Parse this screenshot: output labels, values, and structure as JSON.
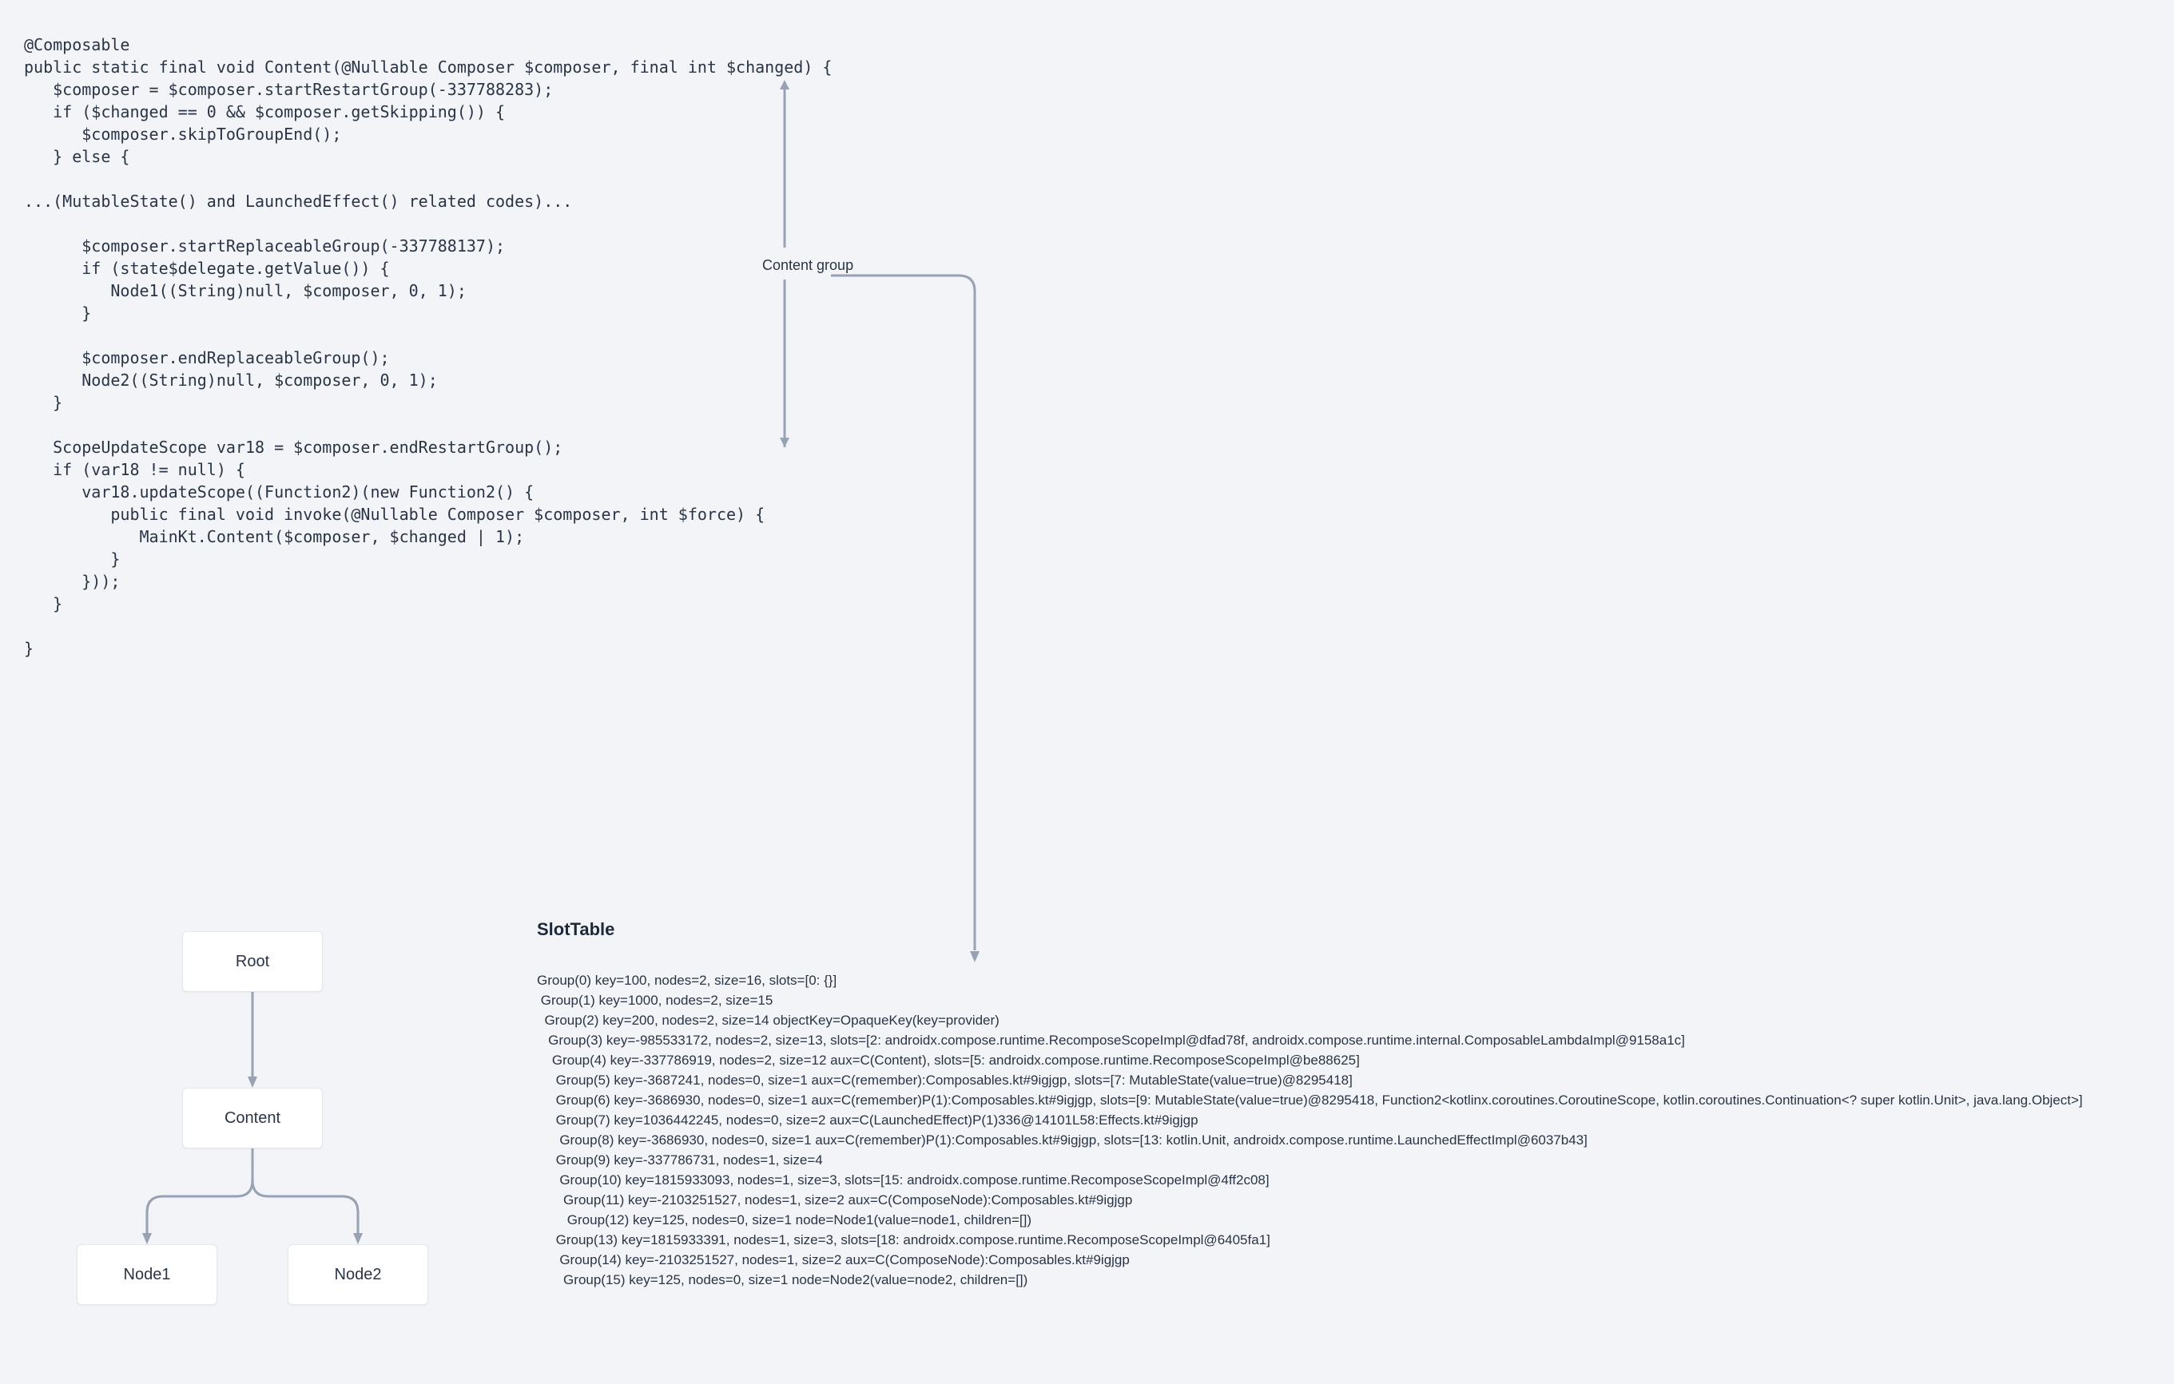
{
  "code": "@Composable\npublic static final void Content(@Nullable Composer $composer, final int $changed) {\n   $composer = $composer.startRestartGroup(-337788283);\n   if ($changed == 0 && $composer.getSkipping()) {\n      $composer.skipToGroupEnd();\n   } else {\n\n...(MutableState() and LaunchedEffect() related codes)...\n\n      $composer.startReplaceableGroup(-337788137);\n      if (state$delegate.getValue()) {\n         Node1((String)null, $composer, 0, 1);\n      }\n\n      $composer.endReplaceableGroup();\n      Node2((String)null, $composer, 0, 1);\n   }\n\n   ScopeUpdateScope var18 = $composer.endRestartGroup();\n   if (var18 != null) {\n      var18.updateScope((Function2)(new Function2() {\n         public final void invoke(@Nullable Composer $composer, int $force) {\n            MainKt.Content($composer, $changed | 1);\n         }\n      }));\n   }\n\n}",
  "contentGroupLabel": "Content group",
  "tree": {
    "root": "Root",
    "content": "Content",
    "node1": "Node1",
    "node2": "Node2"
  },
  "slotTable": {
    "title": "SlotTable",
    "text": "Group(0) key=100, nodes=2, size=16, slots=[0: {}]\n Group(1) key=1000, nodes=2, size=15\n  Group(2) key=200, nodes=2, size=14 objectKey=OpaqueKey(key=provider)\n   Group(3) key=-985533172, nodes=2, size=13, slots=[2: androidx.compose.runtime.RecomposeScopeImpl@dfad78f, androidx.compose.runtime.internal.ComposableLambdaImpl@9158a1c]\n    Group(4) key=-337786919, nodes=2, size=12 aux=C(Content), slots=[5: androidx.compose.runtime.RecomposeScopeImpl@be88625]\n     Group(5) key=-3687241, nodes=0, size=1 aux=C(remember):Composables.kt#9igjgp, slots=[7: MutableState(value=true)@8295418]\n     Group(6) key=-3686930, nodes=0, size=1 aux=C(remember)P(1):Composables.kt#9igjgp, slots=[9: MutableState(value=true)@8295418, Function2<kotlinx.coroutines.CoroutineScope, kotlin.coroutines.Continuation<? super kotlin.Unit>, java.lang.Object>]\n     Group(7) key=1036442245, nodes=0, size=2 aux=C(LaunchedEffect)P(1)336@14101L58:Effects.kt#9igjgp\n      Group(8) key=-3686930, nodes=0, size=1 aux=C(remember)P(1):Composables.kt#9igjgp, slots=[13: kotlin.Unit, androidx.compose.runtime.LaunchedEffectImpl@6037b43]\n     Group(9) key=-337786731, nodes=1, size=4\n      Group(10) key=1815933093, nodes=1, size=3, slots=[15: androidx.compose.runtime.RecomposeScopeImpl@4ff2c08]\n       Group(11) key=-2103251527, nodes=1, size=2 aux=C(ComposeNode):Composables.kt#9igjgp\n        Group(12) key=125, nodes=0, size=1 node=Node1(value=node1, children=[])\n     Group(13) key=1815933391, nodes=1, size=3, slots=[18: androidx.compose.runtime.RecomposeScopeImpl@6405fa1]\n      Group(14) key=-2103251527, nodes=1, size=2 aux=C(ComposeNode):Composables.kt#9igjgp\n       Group(15) key=125, nodes=0, size=1 node=Node2(value=node2, children=[])"
  }
}
